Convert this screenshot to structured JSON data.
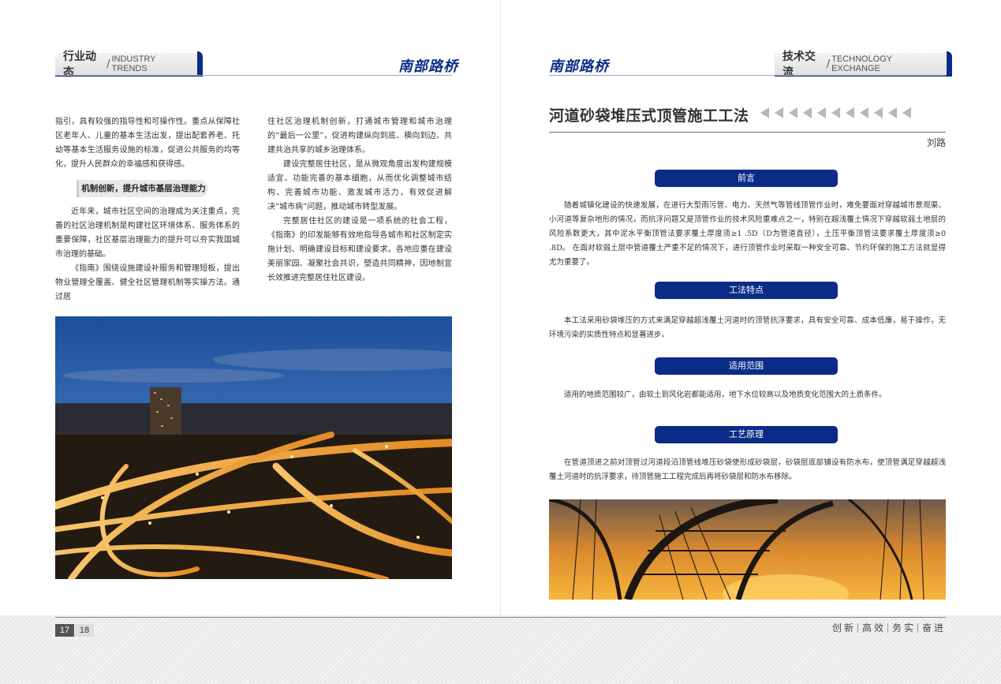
{
  "left": {
    "header": {
      "cn": "行业动态",
      "sep": "/",
      "en": "INDUSTRY TRENDS"
    },
    "brand": "南部路桥",
    "col1": {
      "p1": "指引，具有较强的指导性和可操作性。重点从保障社区老年人、儿童的基本生活出发，提出配套养老、托幼等基本生活服务设施的标准，促进公共服务的均等化，提升人民群众的幸福感和获得感。",
      "subhead": "机制创新，提升城市基层治理能力",
      "p2": "近年来，城市社区空间的治理成为关注重点，完善的社区治理机制是构建社区环境体系、服务体系的重要保障，社区基层治理能力的提升可以夯实我国城市治理的基础。",
      "p3": "《指南》围绕设施建设补服务和管理短板，提出物业管理全覆盖、健全社区管理机制等实操方法。通过居"
    },
    "col2": {
      "p1": "住社区治理机制创新，打通城市管理和城市治理的“最后一公里”，促进构建纵向到底、横向到边、共建共治共享的城乡治理体系。",
      "p2": "建设完整居住社区，是从微观角度出发构建规模适宜、功能完善的基本细胞，从而优化调整城市结构、完善城市功能、激发城市活力，有效促进解决“城市病”问题，推动城市转型发展。",
      "p3": "完整居住社区的建设是一项系统的社会工程，《指南》的印发能够有效地指导各城市和社区制定实施计划、明确建设目标和建设要求。各地应重在建设美丽家园、凝聚社会共识，塑造共同精神，因地制宜长效推进完整居住社区建设。"
    }
  },
  "right": {
    "brand": "南部路桥",
    "header": {
      "cn": "技术交流",
      "sep": "/",
      "en": "TECHNOLOGY EXCHANGE"
    },
    "title": "河道砂袋堆压式顶管施工工法",
    "author": "刘路",
    "sections": [
      {
        "heading": "前言",
        "text": "随着城镇化建设的快速发展，在进行大型雨污管、电力、天然气等管线顶管作业时，难免要面对穿越城市景观渠、小河道等复杂地形的情况，而抗浮问题又是顶管作业的技术风险重难点之一，特别在超浅覆土情况下穿越软弱土地层的风险系数更大，其中泥水平衡顶管法要求覆土厚度须≥1 .5D（D为管道直径），土压平衡顶管法要求覆土厚度须≥0 .8D。 在面对软弱土层中管道覆土严重不足的情况下，进行顶管作业时采取一种安全可靠、节约环保的施工方法就显得尤为重要了。"
      },
      {
        "heading": "工法特点",
        "text": "本工法采用砂袋堆压的方式来满足穿越超浅覆土河道时的顶管抗浮要求，具有安全可靠、成本低廉，易于操作，无环境污染的实质性特点和显著进步。"
      },
      {
        "heading": "适用范围",
        "text": "适用的地质范围较广，由软土到风化岩都能适用，地下水位较高以及地质变化范围大的土质条件。"
      },
      {
        "heading": "工艺原理",
        "text": "在管道顶进之前对顶管过河道段沿顶管线堆压砂袋使形成砂袋层，砂袋层底部铺设有防水布，使顶管满足穿越超浅覆土河道时的抗浮要求，待顶管施工工程完成后再将砂袋层和防水布移除。"
      }
    ]
  },
  "footer": {
    "page_left": "17",
    "page_right": "18",
    "motto": [
      "创新",
      "高效",
      "务实",
      "奋进"
    ]
  },
  "colors": {
    "brand_blue": "#0b2c86"
  }
}
